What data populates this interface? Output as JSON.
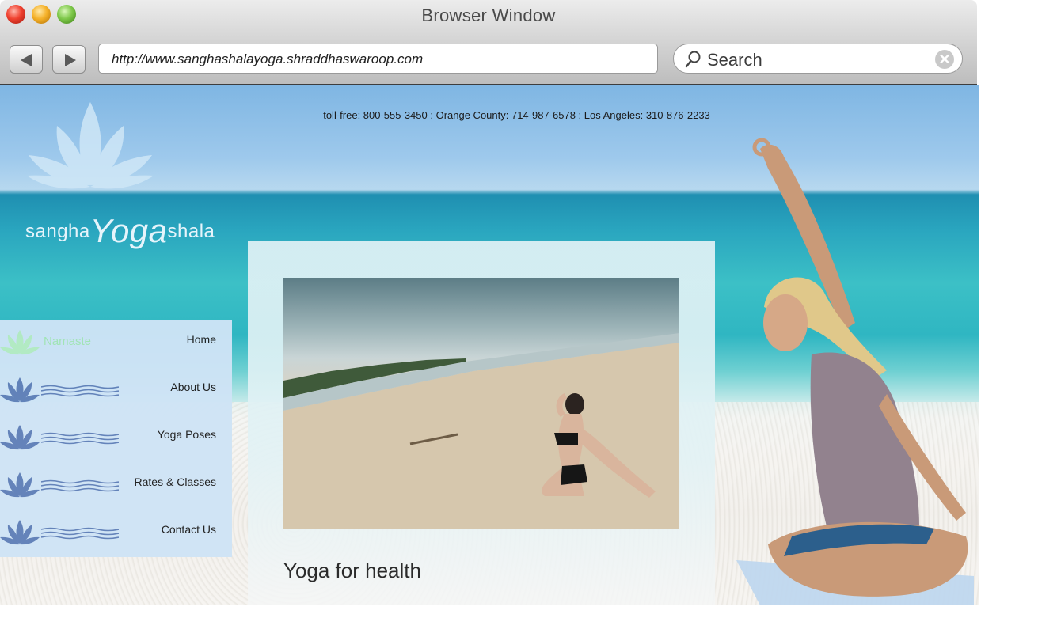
{
  "browser": {
    "title": "Browser Window",
    "url": "http://www.sanghashalayoga.shraddhaswaroop.com",
    "search_placeholder": "Search",
    "clear_glyph": "✕"
  },
  "site": {
    "contact_line": "toll-free: 800-555-3450 : Orange County: 714-987-6578 : Los Angeles: 310-876-2233",
    "logo": {
      "left": "sangha",
      "middle": "Yoga",
      "right": "shala"
    },
    "menu": [
      {
        "label": "Home",
        "accent": "Namaste"
      },
      {
        "label": "About Us"
      },
      {
        "label": "Yoga Poses"
      },
      {
        "label": "Rates & Classes"
      },
      {
        "label": "Contact Us"
      }
    ],
    "content": {
      "heading": "Yoga for health"
    }
  },
  "colors": {
    "menu_bg": "#cfe4f6",
    "lotus": "#5f7fb8",
    "home_accent": "#a6e6b5",
    "sky": "#7fb6e3",
    "sea": "#2aa6bf"
  },
  "icons": [
    "lotus-icon",
    "wave-icon",
    "search-icon",
    "clear-icon",
    "back-arrow-icon",
    "forward-arrow-icon"
  ]
}
